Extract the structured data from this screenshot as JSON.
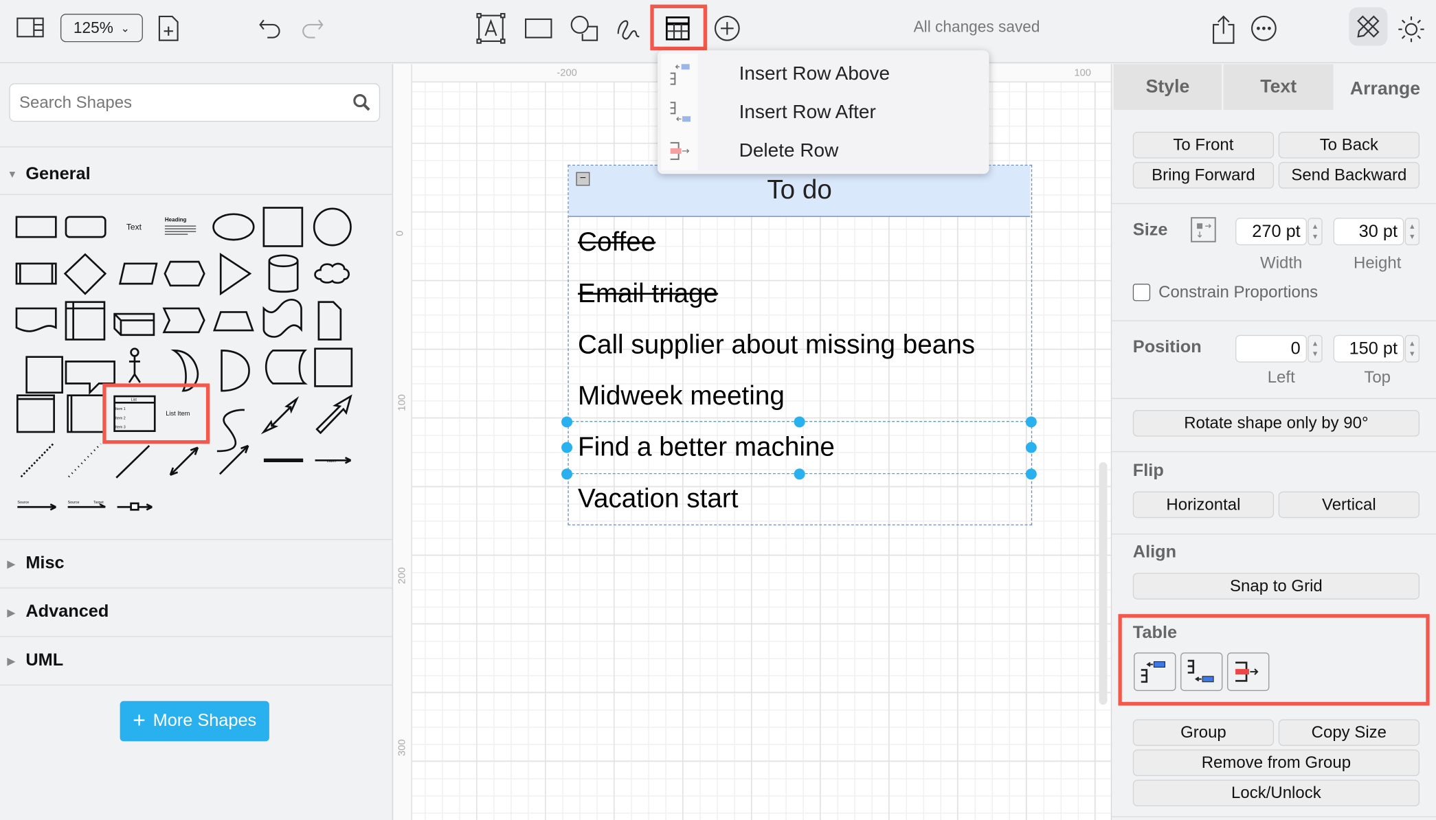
{
  "toolbar": {
    "zoom": "125%",
    "status": "All changes saved"
  },
  "sidebar": {
    "search_placeholder": "Search Shapes",
    "sections": [
      "General",
      "Misc",
      "Advanced",
      "UML"
    ],
    "more_shapes": "More Shapes",
    "shape_labels": {
      "text": "Text",
      "heading": "Heading",
      "list": "List",
      "item1": "Item 1",
      "item2": "Item 2",
      "item3": "Item 3",
      "list_item": "List Item",
      "label": "Label",
      "source": "Source",
      "target": "Target"
    }
  },
  "canvas": {
    "ruler_top": [
      "-200",
      "100"
    ],
    "ruler_left": [
      "0",
      "100",
      "200",
      "300"
    ],
    "table": {
      "title": "To do",
      "rows": [
        {
          "text": "Coffee",
          "done": true
        },
        {
          "text": "Email triage",
          "done": true
        },
        {
          "text": "Call supplier about missing beans",
          "done": false
        },
        {
          "text": "Midweek meeting",
          "done": false
        },
        {
          "text": "Find a better machine",
          "done": false
        },
        {
          "text": "Vacation start",
          "done": false
        }
      ]
    }
  },
  "menu": {
    "items": [
      "Insert Row Above",
      "Insert Row After",
      "Delete Row"
    ]
  },
  "panel": {
    "tabs": [
      "Style",
      "Text",
      "Arrange"
    ],
    "order": [
      "To Front",
      "To Back",
      "Bring Forward",
      "Send Backward"
    ],
    "size": {
      "label": "Size",
      "width": "270 pt",
      "height": "30 pt",
      "width_label": "Width",
      "height_label": "Height",
      "constrain": "Constrain Proportions"
    },
    "position": {
      "label": "Position",
      "left": "0",
      "top": "150 pt",
      "left_label": "Left",
      "top_label": "Top"
    },
    "rotate": "Rotate shape only by 90°",
    "flip": {
      "label": "Flip",
      "horizontal": "Horizontal",
      "vertical": "Vertical"
    },
    "align": {
      "label": "Align",
      "snap": "Snap to Grid"
    },
    "table": {
      "label": "Table"
    },
    "group": [
      "Group",
      "Copy Size",
      "Remove from Group",
      "Lock/Unlock"
    ]
  },
  "colors": {
    "accent": "#29b0ee",
    "highlight": "#f4574b",
    "header": "#dae8fc"
  }
}
